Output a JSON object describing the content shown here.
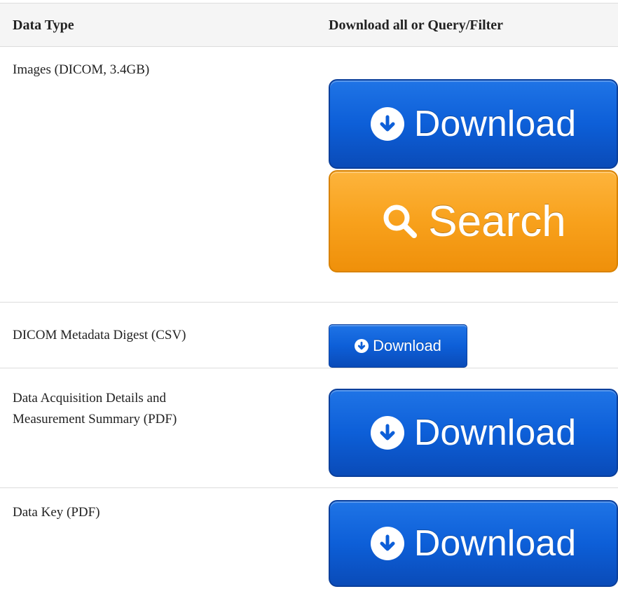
{
  "table": {
    "headers": {
      "col1": "Data Type",
      "col2": "Download all or Query/Filter"
    },
    "rows": [
      {
        "label": "Images (DICOM, 3.4GB)",
        "download_label": "Download",
        "search_label": "Search"
      },
      {
        "label": "DICOM Metadata Digest (CSV)",
        "download_label": "Download"
      },
      {
        "label_line1": "Data Acquisition Details and",
        "label_line2": "Measurement Summary (PDF)",
        "download_label": "Download"
      },
      {
        "label": "Data Key (PDF)",
        "download_label": "Download"
      }
    ]
  },
  "colors": {
    "download_button": "#0d5fd8",
    "search_button": "#f8a11c",
    "header_background": "#f5f5f5",
    "border": "#dddddd"
  },
  "icons": {
    "download": "arrow-down-circle-icon",
    "search": "magnifier-icon"
  }
}
